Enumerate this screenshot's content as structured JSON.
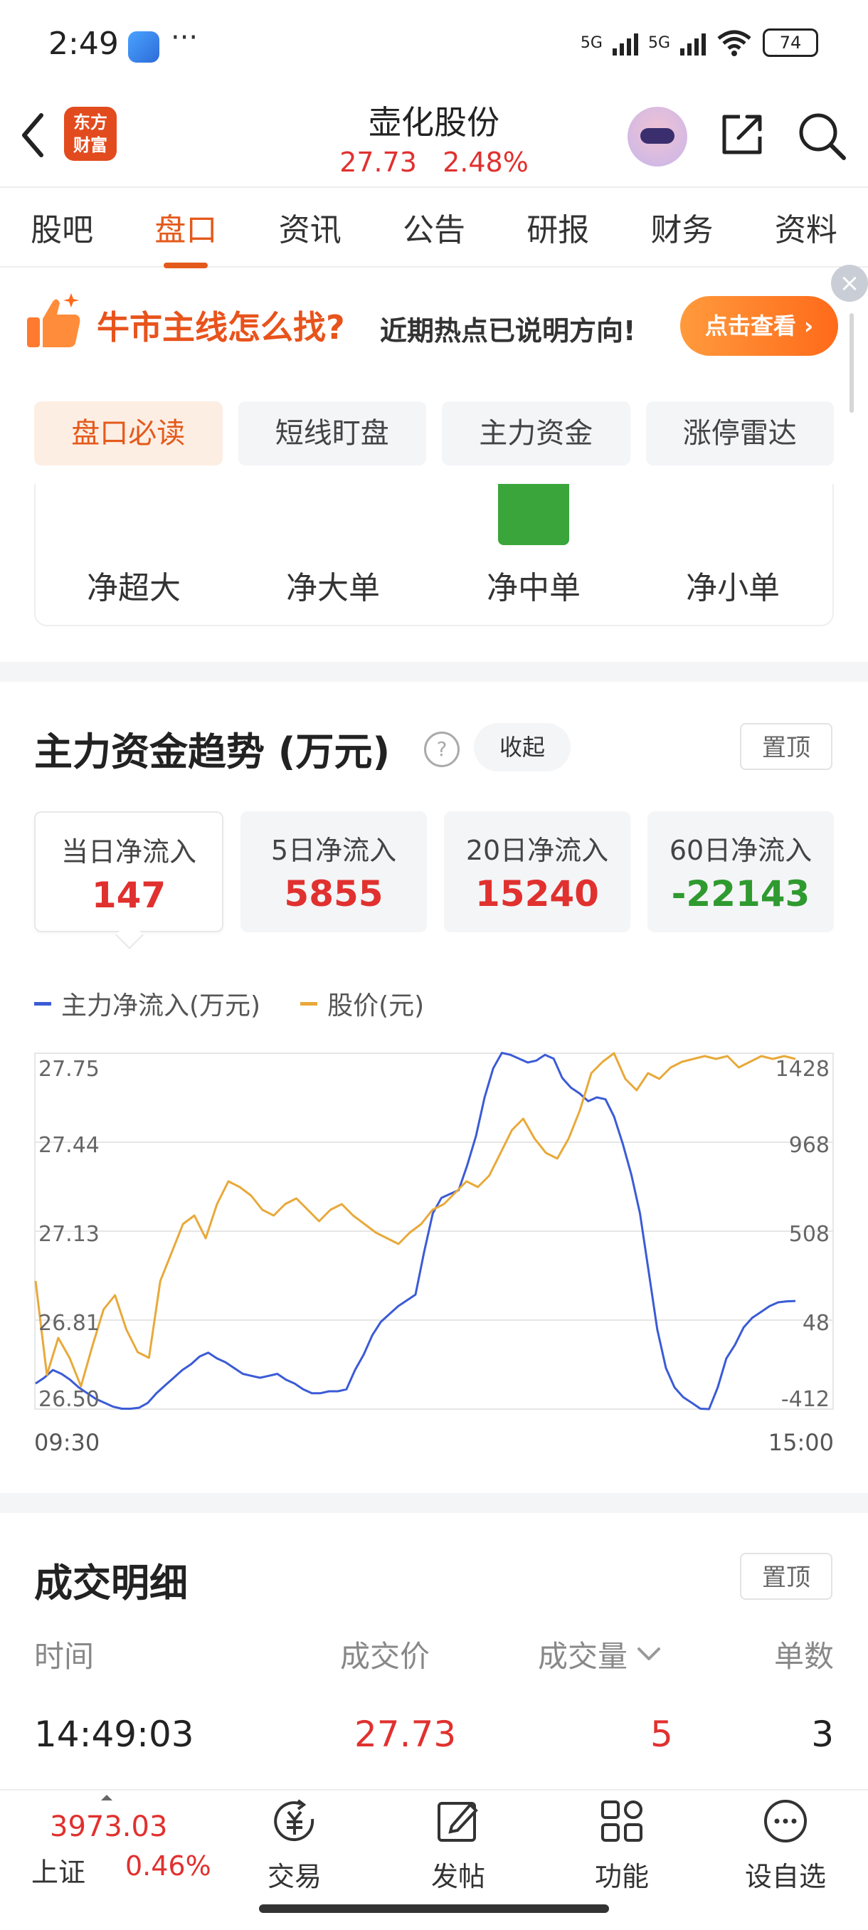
{
  "status_bar": {
    "time": "2:49",
    "more": "···",
    "network_1": "5G",
    "network_2": "5G",
    "battery": "74"
  },
  "header": {
    "logo_line1": "东方",
    "logo_line2": "财富",
    "stock_name": "壶化股份",
    "price": "27.73",
    "change_pct": "2.48%"
  },
  "tabs": [
    "股吧",
    "盘口",
    "资讯",
    "公告",
    "研报",
    "财务",
    "资料"
  ],
  "active_tab": "盘口",
  "banner": {
    "title": "牛市主线怎么找?",
    "subtitle": "近期热点已说明方向!",
    "button": "点击查看 ›",
    "close": "×"
  },
  "sub_tabs": [
    "盘口必读",
    "短线盯盘",
    "主力资金",
    "涨停雷达"
  ],
  "order_sizes": [
    "净超大",
    "净大单",
    "净中单",
    "净小单"
  ],
  "trend": {
    "title": "主力资金趋势 (万元)",
    "help": "?",
    "collapse": "收起",
    "pin": "置顶",
    "flows": [
      {
        "label": "当日净流入",
        "value": "147",
        "sign": "pos"
      },
      {
        "label": "5日净流入",
        "value": "5855",
        "sign": "pos"
      },
      {
        "label": "20日净流入",
        "value": "15240",
        "sign": "pos"
      },
      {
        "label": "60日净流入",
        "value": "-22143",
        "sign": "neg"
      }
    ],
    "legend": [
      {
        "name": "主力净流入(万元)",
        "color": "#3b5bd6"
      },
      {
        "name": "股价(元)",
        "color": "#e8a93a"
      }
    ],
    "time_start": "09:30",
    "time_end": "15:00"
  },
  "chart_data": {
    "type": "line",
    "left_axis_ticks": [
      "27.75",
      "27.44",
      "27.13",
      "26.81",
      "26.50"
    ],
    "right_axis_ticks": [
      "1428",
      "968",
      "508",
      "48",
      "-412"
    ],
    "left_range": [
      26.5,
      27.75
    ],
    "right_range": [
      -412,
      1428
    ],
    "x_start": "09:30",
    "x_end": "15:00",
    "grid": true,
    "series": [
      {
        "name": "主力净流入(万元)",
        "axis": "right",
        "color": "#3b5bd6",
        "values": [
          -280,
          -250,
          -210,
          -230,
          -260,
          -300,
          -330,
          -360,
          -380,
          -400,
          -410,
          -410,
          -405,
          -380,
          -330,
          -290,
          -250,
          -210,
          -180,
          -140,
          -120,
          -150,
          -170,
          -200,
          -230,
          -240,
          -250,
          -240,
          -230,
          -260,
          -280,
          -310,
          -330,
          -330,
          -320,
          -320,
          -310,
          -210,
          -130,
          -30,
          40,
          80,
          120,
          150,
          180,
          400,
          600,
          680,
          700,
          720,
          850,
          1000,
          1200,
          1350,
          1430,
          1420,
          1400,
          1380,
          1390,
          1420,
          1400,
          1300,
          1250,
          1220,
          1180,
          1200,
          1190,
          1100,
          960,
          800,
          600,
          300,
          0,
          -200,
          -300,
          -350,
          -380,
          -410,
          -412,
          -300,
          -150,
          -80,
          10,
          60,
          90,
          120,
          140,
          145,
          147
        ]
      },
      {
        "name": "股价(元)",
        "axis": "left",
        "color": "#e8a93a",
        "values": [
          26.95,
          26.62,
          26.75,
          26.68,
          26.58,
          26.72,
          26.85,
          26.9,
          26.78,
          26.7,
          26.68,
          26.95,
          27.05,
          27.15,
          27.18,
          27.1,
          27.22,
          27.3,
          27.28,
          27.25,
          27.2,
          27.18,
          27.22,
          27.24,
          27.2,
          27.16,
          27.2,
          27.22,
          27.18,
          27.15,
          27.12,
          27.1,
          27.08,
          27.12,
          27.15,
          27.2,
          27.22,
          27.26,
          27.3,
          27.28,
          27.32,
          27.4,
          27.48,
          27.52,
          27.45,
          27.4,
          27.38,
          27.45,
          27.55,
          27.68,
          27.72,
          27.75,
          27.66,
          27.62,
          27.68,
          27.66,
          27.7,
          27.72,
          27.73,
          27.74,
          27.73,
          27.74,
          27.7,
          27.72,
          27.74,
          27.73,
          27.74,
          27.73
        ]
      }
    ]
  },
  "trades": {
    "title": "成交明细",
    "pin": "置顶",
    "headers": [
      "时间",
      "成交价",
      "成交量",
      "单数"
    ],
    "sort_icon": "chevron-down-icon",
    "rows": [
      {
        "time": "14:49:03",
        "price": "27.73",
        "volume": "5",
        "count": "3"
      }
    ]
  },
  "bottom_bar": {
    "index_value": "3973.03",
    "index_name": "上证",
    "index_change": "0.46%",
    "nav": [
      "交易",
      "发帖",
      "功能",
      "设自选"
    ]
  },
  "colors": {
    "accent": "#e45a1c",
    "up": "#e0312f",
    "down": "#2f9a2f"
  }
}
